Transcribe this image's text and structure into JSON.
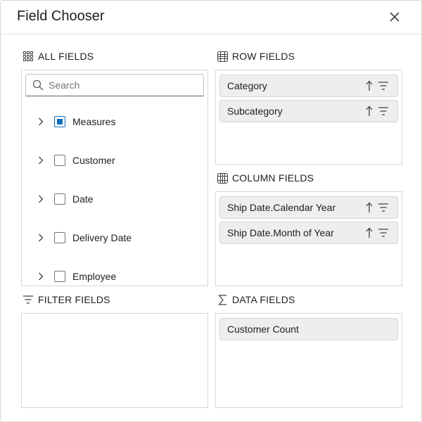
{
  "dialog": {
    "title": "Field Chooser"
  },
  "sections": {
    "all_fields": {
      "title": "ALL FIELDS",
      "search_placeholder": "Search",
      "items": [
        {
          "label": "Measures",
          "checked": "partial"
        },
        {
          "label": "Customer",
          "checked": false
        },
        {
          "label": "Date",
          "checked": false
        },
        {
          "label": "Delivery Date",
          "checked": false
        },
        {
          "label": "Employee",
          "checked": false
        }
      ]
    },
    "row_fields": {
      "title": "ROW FIELDS",
      "items": [
        {
          "label": "Category"
        },
        {
          "label": "Subcategory"
        }
      ]
    },
    "column_fields": {
      "title": "COLUMN FIELDS",
      "items": [
        {
          "label": "Ship Date.Calendar Year"
        },
        {
          "label": "Ship Date.Month of Year"
        }
      ]
    },
    "filter_fields": {
      "title": "FILTER FIELDS",
      "items": []
    },
    "data_fields": {
      "title": "DATA FIELDS",
      "items": [
        {
          "label": "Customer Count"
        }
      ]
    }
  },
  "colors": {
    "accent": "#0f6cbd",
    "chip_bg": "#eeeeee",
    "border": "#d6d6d6"
  },
  "icons": [
    "close-icon",
    "grid-icon",
    "table-icon",
    "filter-lines-icon",
    "sigma-icon",
    "search-icon",
    "chevron-right-icon",
    "sort-ascending-icon",
    "filter-icon"
  ]
}
